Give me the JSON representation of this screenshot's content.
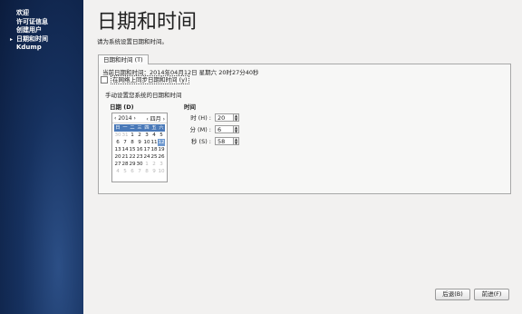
{
  "sidebar": {
    "items": [
      {
        "label": "欢迎",
        "active": false
      },
      {
        "label": "许可证信息",
        "active": false
      },
      {
        "label": "创建用户",
        "active": false
      },
      {
        "label": "日期和时间",
        "active": true
      },
      {
        "label": "Kdump",
        "active": false
      }
    ],
    "active_marker": "▸"
  },
  "main": {
    "title": "日期和时间",
    "instruction": "请为系统设置日期和时间。",
    "tab_label": "日期和时间 (T)",
    "current_time": "当前日期和时间：2014年04月12日 星期六 20时27分40秒",
    "ntp_label": "在网络上同步日期和时间 (y)",
    "ntp_checked": false,
    "manual_label": "手动设置您系统的日期和时间",
    "date_heading": "日期 (D)",
    "time_heading": "时间"
  },
  "calendar": {
    "prev_year": "‹",
    "year": "2014",
    "next_year": "›",
    "prev_month": "‹",
    "month": "四月",
    "next_month": "›",
    "day_names": [
      "日",
      "一",
      "二",
      "三",
      "四",
      "五",
      "六"
    ],
    "selected_day": 12,
    "weeks": [
      [
        {
          "d": "30",
          "dim": true
        },
        {
          "d": "31",
          "dim": true
        },
        {
          "d": "1"
        },
        {
          "d": "2"
        },
        {
          "d": "3"
        },
        {
          "d": "4"
        },
        {
          "d": "5"
        }
      ],
      [
        {
          "d": "6"
        },
        {
          "d": "7"
        },
        {
          "d": "8"
        },
        {
          "d": "9"
        },
        {
          "d": "10"
        },
        {
          "d": "11"
        },
        {
          "d": "12"
        }
      ],
      [
        {
          "d": "13"
        },
        {
          "d": "14"
        },
        {
          "d": "15"
        },
        {
          "d": "16"
        },
        {
          "d": "17"
        },
        {
          "d": "18"
        },
        {
          "d": "19"
        }
      ],
      [
        {
          "d": "20"
        },
        {
          "d": "21"
        },
        {
          "d": "22"
        },
        {
          "d": "23"
        },
        {
          "d": "24"
        },
        {
          "d": "25"
        },
        {
          "d": "26"
        }
      ],
      [
        {
          "d": "27"
        },
        {
          "d": "28"
        },
        {
          "d": "29"
        },
        {
          "d": "30"
        },
        {
          "d": "1",
          "dim": true
        },
        {
          "d": "2",
          "dim": true
        },
        {
          "d": "3",
          "dim": true
        }
      ],
      [
        {
          "d": "4",
          "dim": true
        },
        {
          "d": "5",
          "dim": true
        },
        {
          "d": "6",
          "dim": true
        },
        {
          "d": "7",
          "dim": true
        },
        {
          "d": "8",
          "dim": true
        },
        {
          "d": "9",
          "dim": true
        },
        {
          "d": "10",
          "dim": true
        }
      ]
    ]
  },
  "time": {
    "hour_label": "时 (H) :",
    "hour": "20",
    "minute_label": "分 (M) :",
    "minute": "6",
    "second_label": "秒 (S) :",
    "second": "58",
    "spin_up": "▲",
    "spin_down": "▼"
  },
  "buttons": {
    "back": "后退(B)",
    "forward": "前进(F)"
  }
}
